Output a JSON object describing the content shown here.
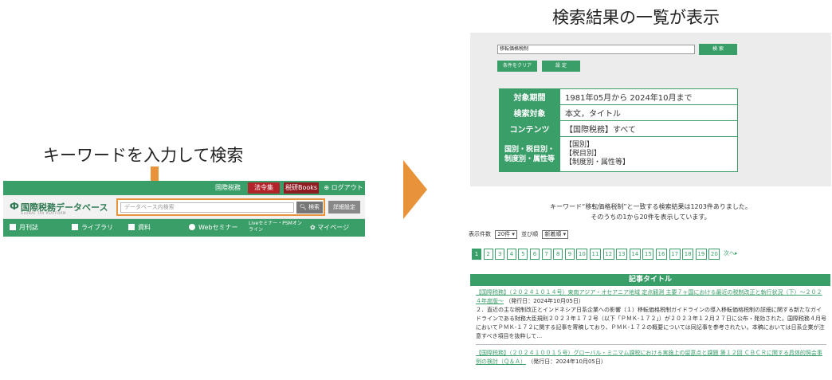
{
  "captions": {
    "left": "キーワードを入力して検索",
    "right": "検索結果の一覧が表示"
  },
  "left_header": {
    "top_links": [
      "国際税務",
      "法令集",
      "税研Books",
      "ログアウト"
    ],
    "logo_text": "国際税務データベース",
    "logo_subtitle": "GLOBAL TAX PLATFORM",
    "search_placeholder": "データベース内検索",
    "search_button": "検索",
    "detail_button": "詳細設定",
    "nav": [
      "月刊誌",
      "ライブラリ",
      "資料",
      "Webセミナー",
      "Liveセミナー・PSMオンライン",
      "マイページ"
    ]
  },
  "result_page": {
    "search_value": "移転価格税制",
    "search_button": "検 索",
    "clear_button": "条件をクリア",
    "settings_button": "設 定",
    "conditions": [
      {
        "label": "対象期間",
        "value": "1981年05月から 2024年10月まで"
      },
      {
        "label": "検索対象",
        "value": "本文，タイトル"
      },
      {
        "label": "コンテンツ",
        "value": "【国際税務】すべて"
      },
      {
        "label_lines": [
          "国別・税目別・",
          "制度別・属性等"
        ],
        "value_lines": [
          "【国別】",
          "【税目別】",
          "【制度別・属性等】"
        ]
      }
    ],
    "result_message_line1": "キーワード“移転価格税制”と一致する検索結果は1203件ありました。",
    "result_message_line2": "そのうちの1から20件を表示しています。",
    "sort": {
      "count_label": "表示件数",
      "count_value": "20件",
      "order_label": "並び順",
      "order_value": "新着順"
    },
    "pages": [
      "1",
      "2",
      "3",
      "4",
      "5",
      "6",
      "7",
      "8",
      "9",
      "10",
      "11",
      "12",
      "13",
      "14",
      "15",
      "16",
      "17",
      "18",
      "19",
      "20"
    ],
    "current_page": "1",
    "next_label": "次へ▸",
    "article_header": "記事タイトル",
    "articles": [
      {
        "title": "【国際税務】（２０２４１０１４号）東南アジア・オセアニア地域 定点観測 主要７ヶ国における最近の税制改正と執行状況（下）～２０２４年度版～",
        "date": "（発行日：2024年10月05日）",
        "desc": "２．直近の主な税制改正とインドネシア日系企業への影響（１）移転価格税制ガイドラインの導入移転価格税制の詳細に関する新たなガイドラインである財務大臣規則２０２３年１７２号（以下「ＰＭＫ-１７２」）が２０２３年１２月２７日に公布・発効された。国際税務４月号においてＰＭＫ-１７２に関する記事を寄稿しており、ＰＭＫ-１７２の概要については同記事を参考されたい。本稿においては日系企業が注意すべき項目を抜粋して…"
      },
      {
        "title": "【国際税務】（２０２４１００１５号）グローバル・ミニマム課税における実施上の留意点と課題 第１２回 ＣＢＣＲに関する具体的照会事例の検討（Ｑ＆Ａ）",
        "date": "（発行日：2024年10月05日）",
        "desc": ""
      }
    ]
  },
  "colors": {
    "brand_green": "#3a9e69",
    "accent_orange": "#e8923a",
    "red_tab": "#b3242a"
  }
}
